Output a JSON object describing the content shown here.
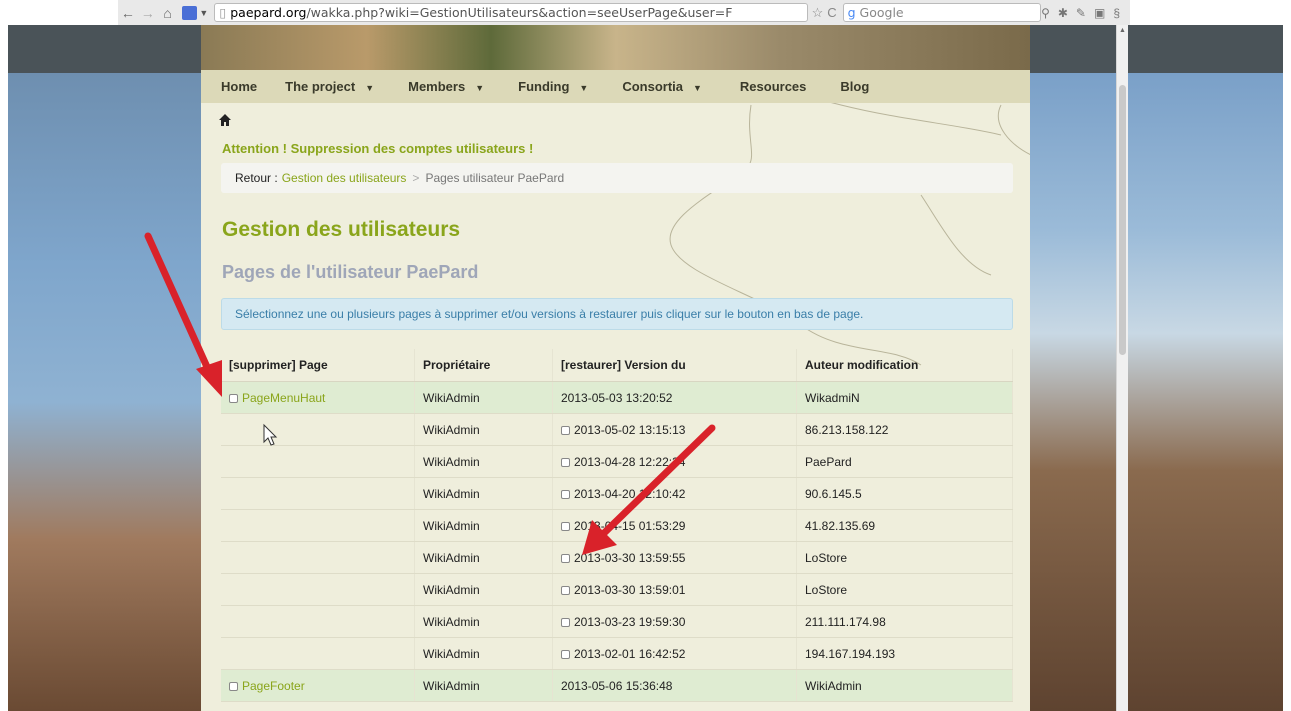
{
  "browser": {
    "url_domain": "paepard.org",
    "url_rest": "/wakka.php?wiki=GestionUtilisateurs&action=seeUserPage&user=F",
    "search_placeholder": "Google"
  },
  "nav": {
    "items": [
      {
        "label": "Home",
        "has_menu": false
      },
      {
        "label": "The project",
        "has_menu": true
      },
      {
        "label": "Members",
        "has_menu": true
      },
      {
        "label": "Funding",
        "has_menu": true
      },
      {
        "label": "Consortia",
        "has_menu": true
      },
      {
        "label": "Resources",
        "has_menu": false
      },
      {
        "label": "Blog",
        "has_menu": false
      }
    ],
    "menu_caret": "▼"
  },
  "alert_title": "Attention ! Suppression des comptes utilisateurs !",
  "breadcrumb": {
    "label": "Retour :",
    "link": "Gestion des utilisateurs",
    "separator": ">",
    "current": "Pages utilisateur PaePard"
  },
  "heading": "Gestion des utilisateurs",
  "subheading": "Pages de l'utilisateur PaePard",
  "info_text": "Sélectionnez une ou plusieurs pages à supprimer et/ou versions à restaurer puis cliquer sur le bouton en bas de page.",
  "table": {
    "headers": [
      "[supprimer] Page",
      "Propriétaire",
      "[restaurer] Version du",
      "Auteur modification"
    ],
    "rows": [
      {
        "page": "PageMenuHaut",
        "owner": "WikiAdmin",
        "version": "2013-05-03 13:20:52",
        "author": "WikadmiN"
      },
      {
        "page": "",
        "owner": "WikiAdmin",
        "version": "2013-05-02 13:15:13",
        "author": "86.213.158.122"
      },
      {
        "page": "",
        "owner": "WikiAdmin",
        "version": "2013-04-28 12:22:34",
        "author": "PaePard"
      },
      {
        "page": "",
        "owner": "WikiAdmin",
        "version": "2013-04-20 12:10:42",
        "author": "90.6.145.5"
      },
      {
        "page": "",
        "owner": "WikiAdmin",
        "version": "2013-04-15 01:53:29",
        "author": "41.82.135.69"
      },
      {
        "page": "",
        "owner": "WikiAdmin",
        "version": "2013-03-30 13:59:55",
        "author": "LoStore"
      },
      {
        "page": "",
        "owner": "WikiAdmin",
        "version": "2013-03-30 13:59:01",
        "author": "LoStore"
      },
      {
        "page": "",
        "owner": "WikiAdmin",
        "version": "2013-03-23 19:59:30",
        "author": "211.111.174.98"
      },
      {
        "page": "",
        "owner": "WikiAdmin",
        "version": "2013-02-01 16:42:52",
        "author": "194.167.194.193"
      },
      {
        "page": "PageFooter",
        "owner": "WikiAdmin",
        "version": "2013-05-06 15:36:48",
        "author": "WikiAdmin"
      }
    ]
  },
  "colors": {
    "accent_green": "#8aa51b",
    "annotation_red": "#d9222a",
    "info_blue": "#3a7ea8"
  }
}
